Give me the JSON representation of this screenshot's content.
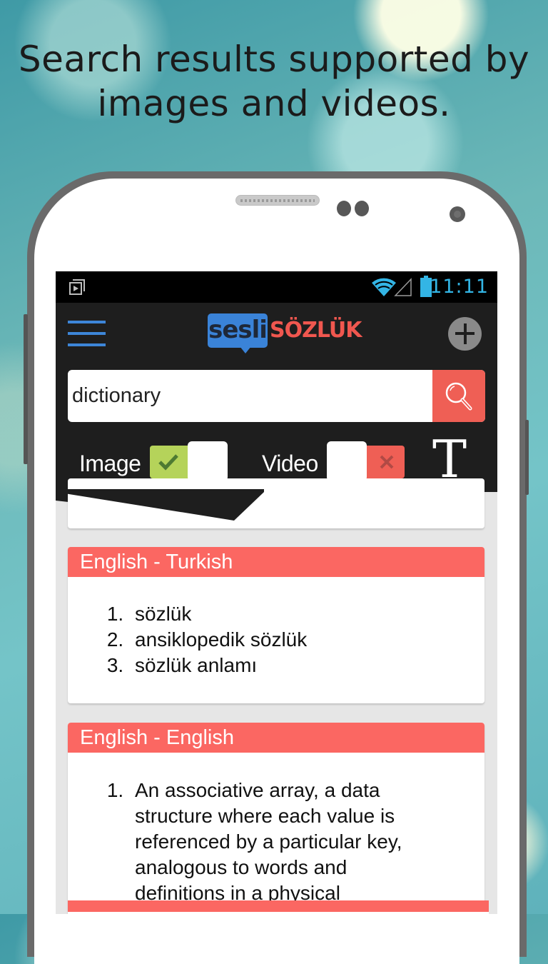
{
  "headline": {
    "line1": "Search results supported by",
    "line2": "images and videos."
  },
  "status_bar": {
    "left_icon": "play-store-icon",
    "icons": [
      "wifi-icon",
      "signal-icon",
      "battery-icon"
    ],
    "time": "11:11",
    "accent_color": "#33b5e5"
  },
  "app_bar": {
    "menu_icon": "hamburger-menu-icon",
    "logo_left": "sesli",
    "logo_right": "SÖZLÜK",
    "add_icon": "plus-circle-icon",
    "logo_blue": "#3a83d8",
    "logo_red": "#f0574f"
  },
  "search": {
    "value": "dictionary",
    "placeholder": "",
    "button_icon": "search-icon",
    "button_color": "#ef5f55"
  },
  "toggles": {
    "image": {
      "label": "Image",
      "on": true,
      "on_color": "#b5d35a"
    },
    "video": {
      "label": "Video",
      "on": false,
      "off_color": "#ef5f55"
    },
    "font_button": "T"
  },
  "results": [
    {
      "title": "English - Turkish",
      "items": [
        "sözlük",
        "ansiklopedik sözlük",
        "sözlük anlamı"
      ]
    },
    {
      "title": "English - English",
      "items": [
        "An associative array, a data structure where each value is referenced by a particular key, analogous to words and definitions in a physical"
      ]
    }
  ],
  "colors": {
    "card_header": "#fb6762",
    "app_bar_bg": "#1e1e1e",
    "content_bg": "#e6e6e6"
  }
}
